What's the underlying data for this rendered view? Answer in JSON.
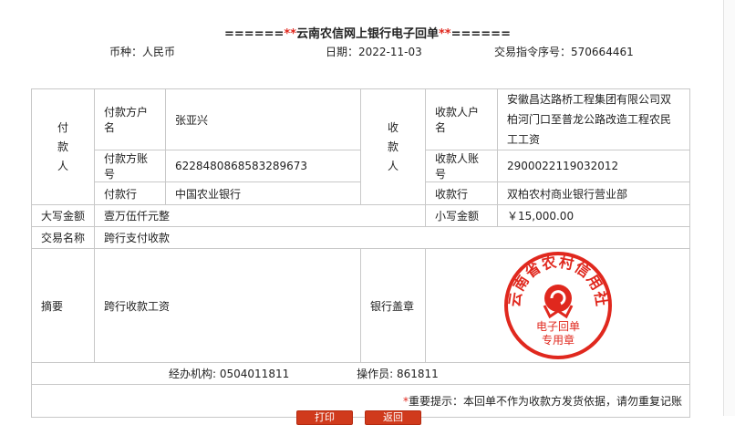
{
  "title": {
    "prefix": "======",
    "star_left": "**",
    "text": "云南农信网上银行电子回单",
    "star_right": "**",
    "suffix": "======"
  },
  "meta": {
    "currency_label": "币种：",
    "currency_value": "人民币",
    "date_label": "日期：",
    "date_value": "2022-11-03",
    "txn_no_label": "交易指令序号：",
    "txn_no_value": "570664461"
  },
  "payer": {
    "section_label": [
      "付",
      "款",
      "人"
    ],
    "name_label": "付款方户名",
    "name_value": "张亚兴",
    "account_label": "付款方账号",
    "account_value": "6228480868583289673",
    "bank_label": "付款行",
    "bank_value": "中国农业银行"
  },
  "payee": {
    "section_label": [
      "收",
      "款",
      "人"
    ],
    "name_label": "收款人户名",
    "name_value": "安徽昌达路桥工程集团有限公司双柏河门口至普龙公路改造工程农民工工资",
    "account_label": "收款人账号",
    "account_value": "2900022119032012",
    "bank_label": "收款行",
    "bank_value": "双柏农村商业银行营业部"
  },
  "amount": {
    "upper_label": "大写金额",
    "upper_value": "壹万伍仟元整",
    "lower_label": "小写金额",
    "lower_value": "￥15,000.00"
  },
  "txn": {
    "name_label": "交易名称",
    "name_value": "跨行支付收款"
  },
  "memo": {
    "label": "摘要",
    "value": "跨行收款工资",
    "seal_label": "银行盖章"
  },
  "seal": {
    "arc_text": "云南省农村信用社",
    "bottom_line1": "电子回单",
    "bottom_line2": "专用章",
    "color": "#e0281e"
  },
  "footer": {
    "org_label": "经办机构:",
    "org_value": "0504011811",
    "operator_label": "操作员:",
    "operator_value": "861811"
  },
  "notice": {
    "star": "*",
    "text": "重要提示：本回单不作为收款方发货依据，请勿重复记账"
  },
  "buttons": {
    "print_label": "打印",
    "back_label": "返回"
  }
}
